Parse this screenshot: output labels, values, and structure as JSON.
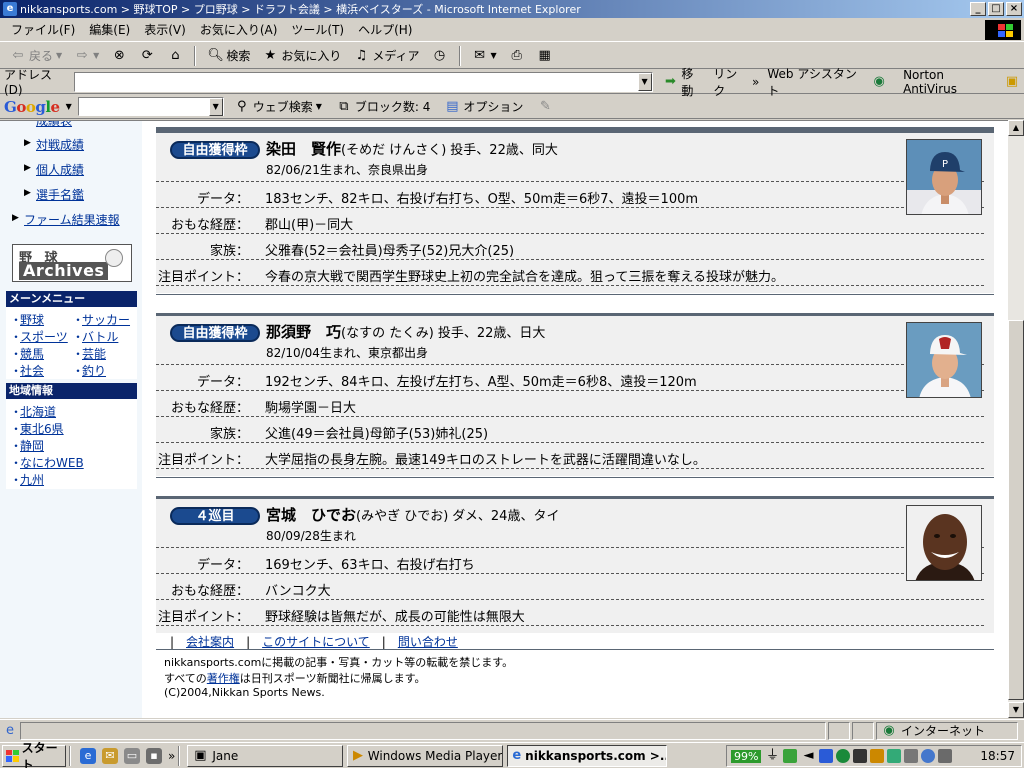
{
  "window": {
    "title": "nikkansports.com > 野球TOP > プロ野球 > ドラフト会議 > 横浜ベイスターズ - Microsoft Internet Explorer",
    "min": "_",
    "max": "□",
    "close": "×"
  },
  "menu": [
    "ファイル(F)",
    "編集(E)",
    "表示(V)",
    "お気に入り(A)",
    "ツール(T)",
    "ヘルプ(H)"
  ],
  "toolbar": {
    "back": "戻る",
    "search": "検索",
    "favorites": "お気に入り",
    "media": "メディア"
  },
  "address": {
    "label": "アドレス(D)",
    "value": "",
    "go": "移動",
    "links": "リンク",
    "web_assistant": "Web アシスタント",
    "antivirus": "Norton AntiVirus"
  },
  "google": {
    "logo_parts": [
      "G",
      "o",
      "o",
      "g",
      "l",
      "e"
    ],
    "search_value": "",
    "web_search": "ウェブ検索",
    "blocked": "ブロック数: 4",
    "options": "オプション"
  },
  "sidebar": {
    "cut_top": "成績表",
    "links": [
      {
        "label": "対戦成績",
        "indent": true
      },
      {
        "label": "個人成績",
        "indent": true
      },
      {
        "label": "選手名鑑",
        "indent": true
      },
      {
        "label": "ファーム結果速報",
        "indent": false
      }
    ],
    "archives_top": "野 球",
    "archives_bottom": "Archives",
    "main_menu_title": "メーンメニュー",
    "main_menu": [
      [
        "野球",
        "サッカー"
      ],
      [
        "スポーツ",
        "バトル"
      ],
      [
        "競馬",
        "芸能"
      ],
      [
        "社会",
        "釣り"
      ]
    ],
    "regional_title": "地域情報",
    "regional": [
      "北海道",
      "東北6県",
      "静岡",
      "なにわWEB",
      "九州"
    ]
  },
  "players": [
    {
      "badge": "自由獲得枠",
      "name": "染田　賢作",
      "reading": "(そめだ けんさく)",
      "info": "投手、22歳、同大",
      "born": "82/06/21生まれ、奈良県出身",
      "rows": [
        {
          "label": "データ：",
          "value": "183センチ、82キロ、右投げ右打ち、O型、50m走＝6秒7、遠投＝100m"
        },
        {
          "label": "おもな経歴：",
          "value": "郡山(甲)－同大"
        },
        {
          "label": "家族：",
          "value": "父雅春(52＝会社員)母秀子(52)兄大介(25)"
        },
        {
          "label": "注目ポイント：",
          "value": "今春の京大戦で関西学生野球史上初の完全試合を達成。狙って三振を奪える投球が魅力。"
        }
      ]
    },
    {
      "badge": "自由獲得枠",
      "name": "那須野　巧",
      "reading": "(なすの たくみ)",
      "info": "投手、22歳、日大",
      "born": "82/10/04生まれ、東京都出身",
      "rows": [
        {
          "label": "データ：",
          "value": "192センチ、84キロ、左投げ左打ち、A型、50m走＝6秒8、遠投＝120m"
        },
        {
          "label": "おもな経歴：",
          "value": "駒場学園－日大"
        },
        {
          "label": "家族：",
          "value": "父進(49＝会社員)母節子(53)姉礼(25)"
        },
        {
          "label": "注目ポイント：",
          "value": "大学屈指の長身左腕。最速149キロのストレートを武器に活躍間違いなし。"
        }
      ]
    },
    {
      "badge": "４巡目",
      "name": "宮城　ひでお",
      "reading": "(みやぎ ひでお)",
      "info": "ダメ、24歳、タイ",
      "born": "80/09/28生まれ",
      "rows": [
        {
          "label": "データ：",
          "value": "169センチ、63キロ、右投げ右打ち"
        },
        {
          "label": "おもな経歴：",
          "value": "バンコク大"
        },
        {
          "label": "注目ポイント：",
          "value": "野球経験は皆無だが、成長の可能性は無限大"
        }
      ]
    }
  ],
  "footer": {
    "links": [
      "会社案内",
      "このサイトについて",
      "問い合わせ"
    ],
    "line1": "nikkansports.comに掲載の記事・写真・カット等の転載を禁じます。",
    "line2_pre": "すべての",
    "line2_link": "著作権",
    "line2_post": "は日刊スポーツ新聞社に帰属します。",
    "line3": "(C)2004,Nikkan Sports News."
  },
  "status": {
    "zone": "インターネット"
  },
  "taskbar": {
    "start": "スタート",
    "tasks": [
      "Jane",
      "Windows Media Player",
      "nikkansports.com >..."
    ],
    "battery": "99%",
    "clock": "18:57"
  }
}
